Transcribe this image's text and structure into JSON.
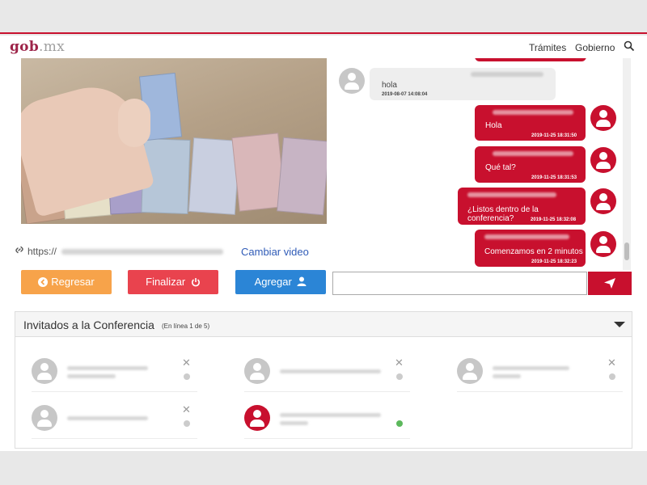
{
  "header": {
    "logo_main": "gob",
    "logo_suffix": ".mx",
    "nav": [
      "Trámites",
      "Gobierno"
    ],
    "search_icon": "search-icon"
  },
  "video": {
    "link_prefix": "https://",
    "change_video_label": "Cambiar video"
  },
  "actions": {
    "back": "Regresar",
    "finish": "Finalizar",
    "add": "Agregar"
  },
  "chat": {
    "messages": [
      {
        "side": "left",
        "text": "hola",
        "time": "2019-08-07 14:08:04"
      },
      {
        "side": "right",
        "text": "Hola",
        "time": "2019-11-25 18:31:50"
      },
      {
        "side": "right",
        "text": "Qué tal?",
        "time": "2019-11-25 18:31:53"
      },
      {
        "side": "right",
        "text": "¿Listos dentro de la conferencia?",
        "time": "2019-11-25 18:32:08"
      },
      {
        "side": "right",
        "text": "Comenzamos en 2 minutos",
        "time": "2019-11-25 18:32:23"
      }
    ],
    "input_value": "",
    "send_icon": "send-icon"
  },
  "guests": {
    "title": "Invitados a la Conferencia",
    "online_status": "(En línea 1 de 5)",
    "items": [
      {
        "online": false,
        "avatar_color": "#c7c7c7"
      },
      {
        "online": false,
        "avatar_color": "#c7c7c7"
      },
      {
        "online": false,
        "avatar_color": "#c7c7c7"
      },
      {
        "online": false,
        "avatar_color": "#c7c7c7"
      },
      {
        "online": true,
        "avatar_color": "#c8102e"
      }
    ]
  },
  "colors": {
    "brand": "#9d2449",
    "accent_red": "#c8102e",
    "back_button": "#f7a34a",
    "finish_button": "#e9434e",
    "add_button": "#2b85d6",
    "online_dot": "#5cb85c",
    "offline_dot": "#cccccc"
  }
}
